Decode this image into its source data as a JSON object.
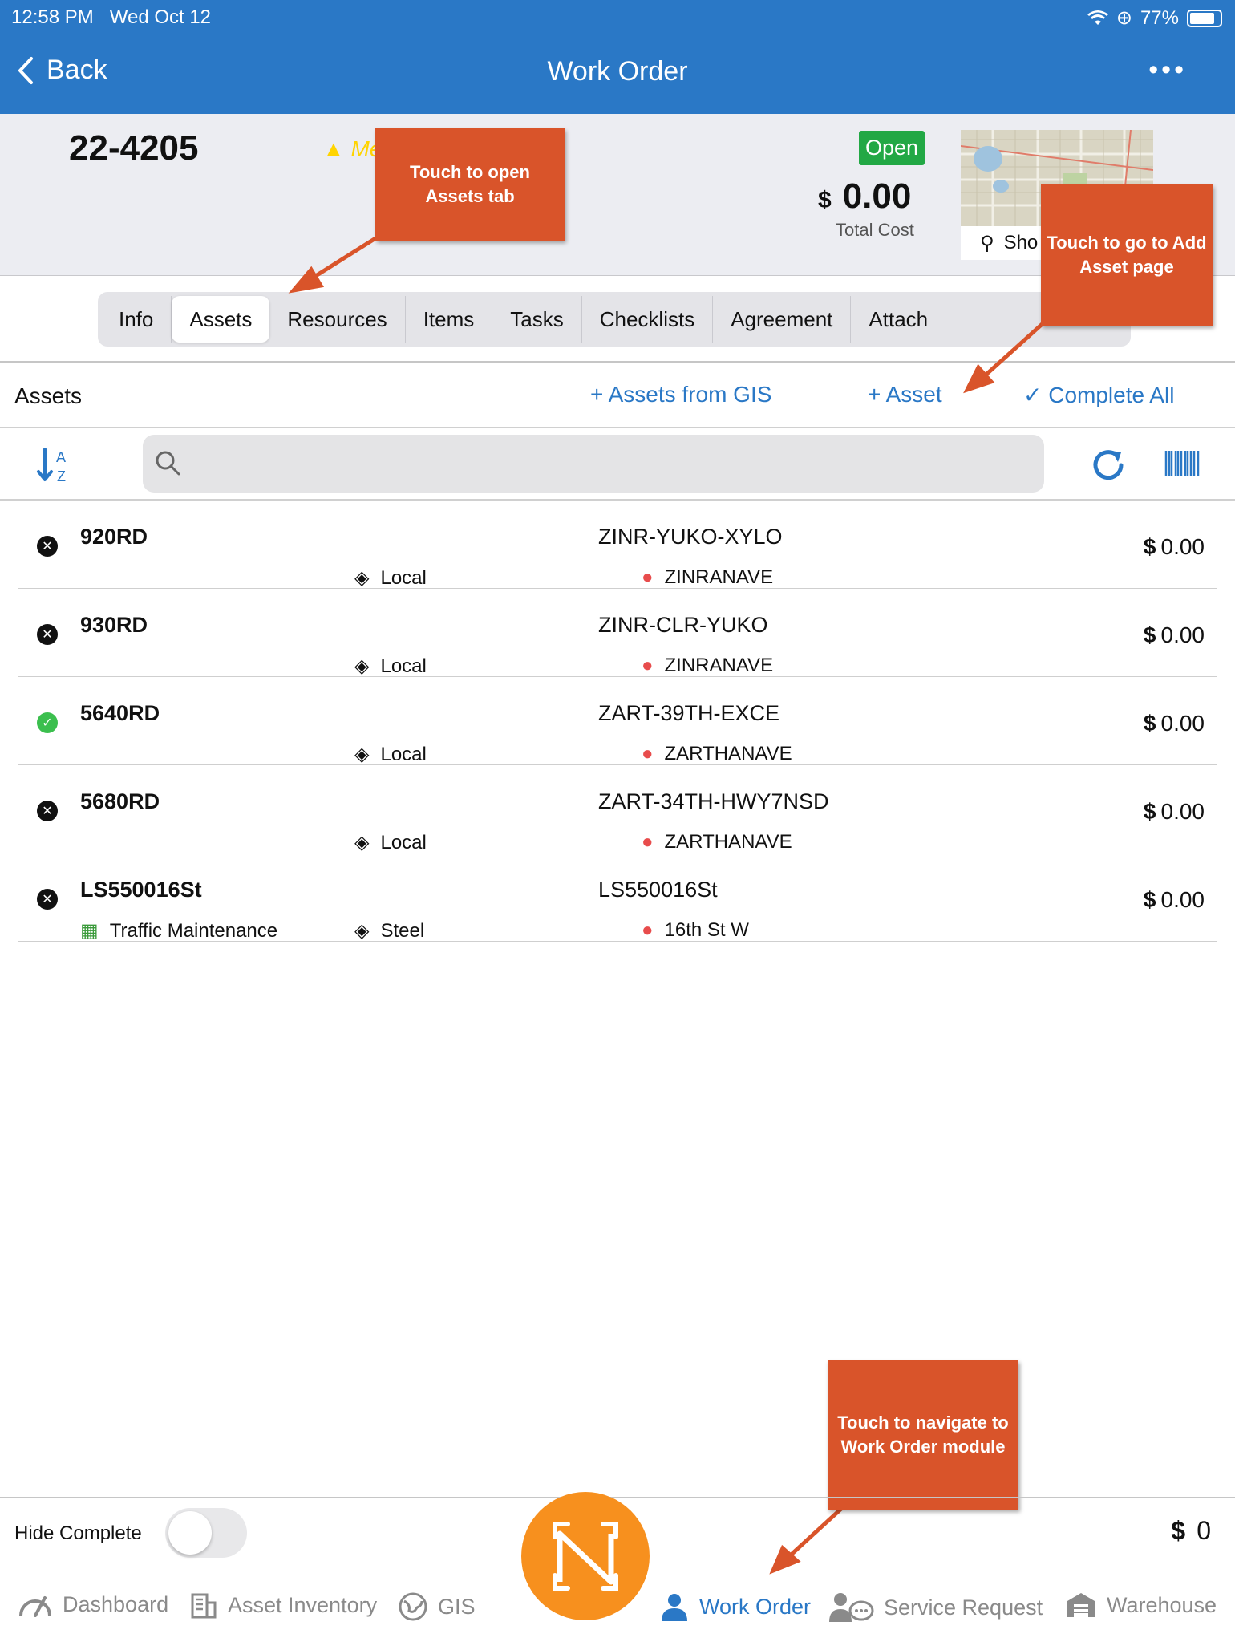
{
  "status_bar": {
    "time": "12:58 PM",
    "date": "Wed Oct 12",
    "battery": "77%"
  },
  "nav": {
    "back_label": "Back",
    "title": "Work Order"
  },
  "header": {
    "work_order_number": "22-4205",
    "priority": "Me",
    "status": "Open",
    "currency": "$",
    "total_cost": "0.00",
    "total_cost_label": "Total Cost",
    "map_show_label": "Sho"
  },
  "tabs": [
    "Info",
    "Assets",
    "Resources",
    "Items",
    "Tasks",
    "Checklists",
    "Agreement",
    "Attach"
  ],
  "assets_section": {
    "title": "Assets",
    "from_gis_label": "+ Assets from GIS",
    "add_asset_label": "+ Asset",
    "complete_all_label": "✓ Complete All",
    "search_placeholder": ""
  },
  "assets": [
    {
      "id": "920RD",
      "code": "ZINR-YUKO-XYLO",
      "type": "Local",
      "location": "ZINRANAVE",
      "cost": "0.00",
      "complete": false,
      "category": ""
    },
    {
      "id": "930RD",
      "code": "ZINR-CLR-YUKO",
      "type": "Local",
      "location": "ZINRANAVE",
      "cost": "0.00",
      "complete": false,
      "category": ""
    },
    {
      "id": "5640RD",
      "code": "ZART-39TH-EXCE",
      "type": "Local",
      "location": "ZARTHANAVE",
      "cost": "0.00",
      "complete": true,
      "category": ""
    },
    {
      "id": "5680RD",
      "code": "ZART-34TH-HWY7NSD",
      "type": "Local",
      "location": "ZARTHANAVE",
      "cost": "0.00",
      "complete": false,
      "category": ""
    },
    {
      "id": "LS550016St",
      "code": "LS550016St",
      "type": "Steel",
      "location": "16th St W",
      "cost": "0.00",
      "complete": false,
      "category": "Traffic Maintenance"
    }
  ],
  "callouts": {
    "assets_tab": "Touch to open Assets tab",
    "add_asset": "Touch to go to Add Asset page",
    "work_order": "Touch to navigate to Work Order module"
  },
  "bottom": {
    "hide_complete_label": "Hide Complete",
    "currency": "$",
    "total": "0",
    "nav_items": [
      "Dashboard",
      "Asset Inventory",
      "GIS",
      "Work Order",
      "Service Request",
      "Warehouse"
    ]
  },
  "colors": {
    "primary": "#2a78c6",
    "open_badge": "#22a845",
    "callout": "#d9542a",
    "center_button": "#f7901e",
    "priority": "#ffd400"
  },
  "icons": [
    "chevron-left-icon",
    "more-dots-icon",
    "warning-icon",
    "map-pin-icon",
    "sort-az-icon",
    "search-icon",
    "refresh-icon",
    "barcode-icon",
    "tag-icon",
    "location-icon",
    "building-icon",
    "dashboard-icon",
    "asset-inventory-icon",
    "gis-globe-icon",
    "work-order-icon",
    "service-request-icon",
    "warehouse-icon"
  ]
}
